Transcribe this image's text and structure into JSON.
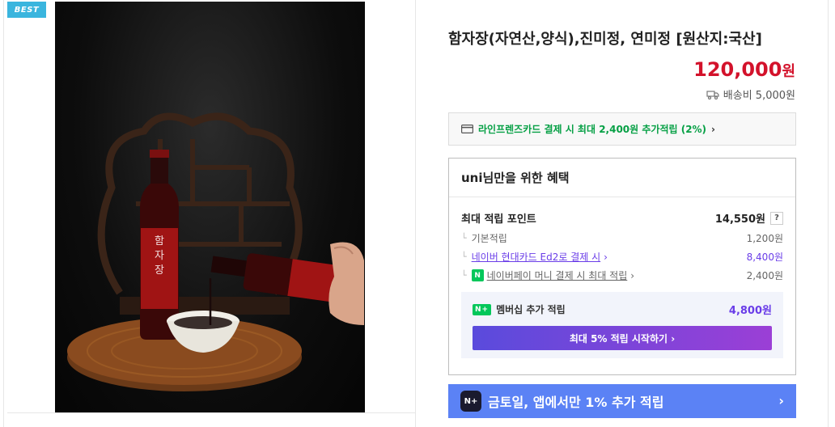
{
  "badge": {
    "label": "BEST"
  },
  "product": {
    "title": "함자장(자연산,양식),진미정, 연미정 [원산지:국산]",
    "price": "120,000",
    "price_unit": "원",
    "shipping": "배송비 5,000원",
    "bottle_label": "함자장"
  },
  "card_promo": {
    "text": "라인프렌즈카드 결제 시 최대 2,400원 추가적립 (2%)",
    "arrow": "›"
  },
  "benefit": {
    "header": "uni님만을 위한 혜택",
    "max_points_label": "최대 적립 포인트",
    "max_points_value": "14,550원",
    "help": "?",
    "rows": [
      {
        "label": "기본적립",
        "value": "1,200원"
      },
      {
        "label": "네이버 현대카드 Ed2로 결제 시",
        "value": "8,400원"
      },
      {
        "label": "네이버페이 머니 결제 시 최대 적립",
        "value": "2,400원"
      }
    ],
    "npay_icon": "N",
    "membership": {
      "badge": "N+",
      "label": "멤버십 추가 적립",
      "value": "4,800원",
      "button": "최대 5% 적립 시작하기 ›"
    }
  },
  "banner": {
    "icon": "N+",
    "text": "금토일, 앱에서만 1% 추가 적립",
    "arrow": "›"
  },
  "colors": {
    "price": "#d3122b",
    "green": "#06a045",
    "purple": "#6a3de8",
    "banner": "#5b82f5",
    "best": "#3ab5de"
  }
}
